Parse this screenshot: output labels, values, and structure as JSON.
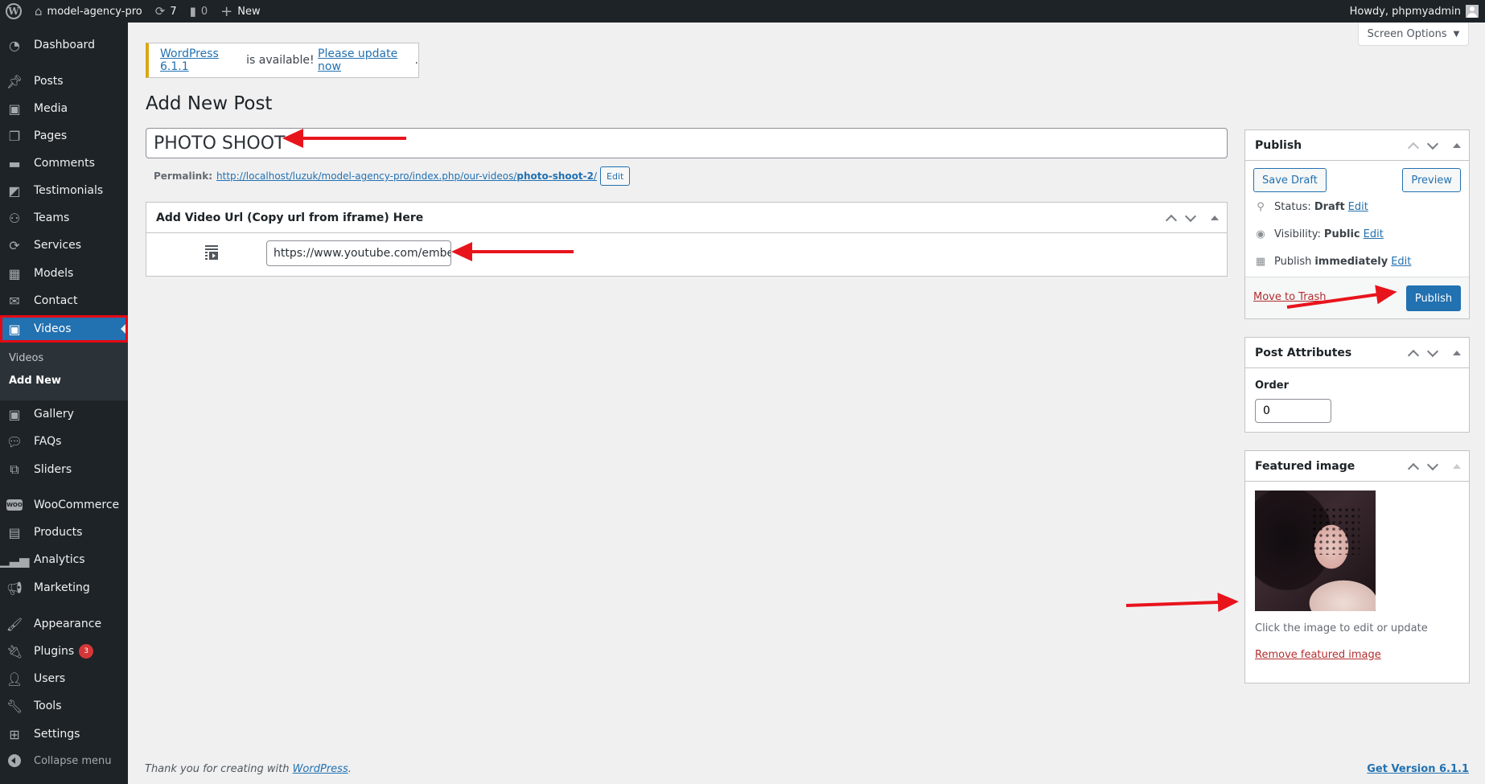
{
  "adminbar": {
    "site_name": "model-agency-pro",
    "updates_count": "7",
    "comments_count": "0",
    "new_label": "New",
    "greeting": "Howdy, phpmyadmin"
  },
  "sidebar": {
    "items": [
      {
        "label": "Dashboard",
        "icon": "dashboard-icon"
      },
      {
        "label": "Posts",
        "icon": "pin-icon"
      },
      {
        "label": "Media",
        "icon": "media-icon"
      },
      {
        "label": "Pages",
        "icon": "pages-icon"
      },
      {
        "label": "Comments",
        "icon": "comment-icon"
      },
      {
        "label": "Testimonials",
        "icon": "testimonials-icon"
      },
      {
        "label": "Teams",
        "icon": "groups-icon"
      },
      {
        "label": "Services",
        "icon": "update-icon"
      },
      {
        "label": "Models",
        "icon": "layout-icon"
      },
      {
        "label": "Contact",
        "icon": "email-icon"
      },
      {
        "label": "Videos",
        "icon": "media-icon",
        "current": true
      },
      {
        "label": "Gallery",
        "icon": "media-icon"
      },
      {
        "label": "FAQs",
        "icon": "chat-bubble-icon"
      },
      {
        "label": "Sliders",
        "icon": "images-icon"
      },
      {
        "label": "WooCommerce",
        "icon": "woo-icon"
      },
      {
        "label": "Products",
        "icon": "archive-icon"
      },
      {
        "label": "Analytics",
        "icon": "bar-chart-icon"
      },
      {
        "label": "Marketing",
        "icon": "megaphone-icon"
      },
      {
        "label": "Appearance",
        "icon": "brush-icon"
      },
      {
        "label": "Plugins",
        "icon": "plug-icon",
        "badge": "3"
      },
      {
        "label": "Users",
        "icon": "user-icon"
      },
      {
        "label": "Tools",
        "icon": "wrench-icon"
      },
      {
        "label": "Settings",
        "icon": "settings-icon"
      }
    ],
    "submenu": [
      "Videos",
      "Add New"
    ],
    "collapse_label": "Collapse menu"
  },
  "screen_options": "Screen Options",
  "notice": {
    "version_link": "WordPress 6.1.1",
    "middle": " is available! ",
    "update_link": "Please update now",
    "end": "."
  },
  "page_title": "Add New Post",
  "post_title": "PHOTO SHOOT",
  "permalink": {
    "label": "Permalink:",
    "base": "http://localhost/luzuk/model-agency-pro/index.php/our-videos/",
    "slug": "photo-shoot-2",
    "trail": "/",
    "edit_label": "Edit"
  },
  "video_box": {
    "title": "Add Video Url (Copy url from iframe) Here",
    "url_value": "https://www.youtube.com/embed"
  },
  "publish_box": {
    "title": "Publish",
    "save_draft": "Save Draft",
    "preview": "Preview",
    "status_label": "Status:",
    "status_value": "Draft",
    "visibility_label": "Visibility:",
    "visibility_value": "Public",
    "publish_label": "Publish",
    "publish_value": "immediately",
    "edit": "Edit",
    "trash": "Move to Trash",
    "publish_button": "Publish"
  },
  "attributes_box": {
    "title": "Post Attributes",
    "order_label": "Order",
    "order_value": "0"
  },
  "featured_box": {
    "title": "Featured image",
    "hint": "Click the image to edit or update",
    "remove": "Remove featured image"
  },
  "footer": {
    "thanks": "Thank you for creating with ",
    "wp_link": "WordPress",
    "period": ".",
    "version": "Get Version 6.1.1"
  },
  "colors": {
    "accent": "#2271b1",
    "sidebar_bg": "#1d2327",
    "danger": "#b32d2e",
    "annotation": "#e8141c"
  }
}
